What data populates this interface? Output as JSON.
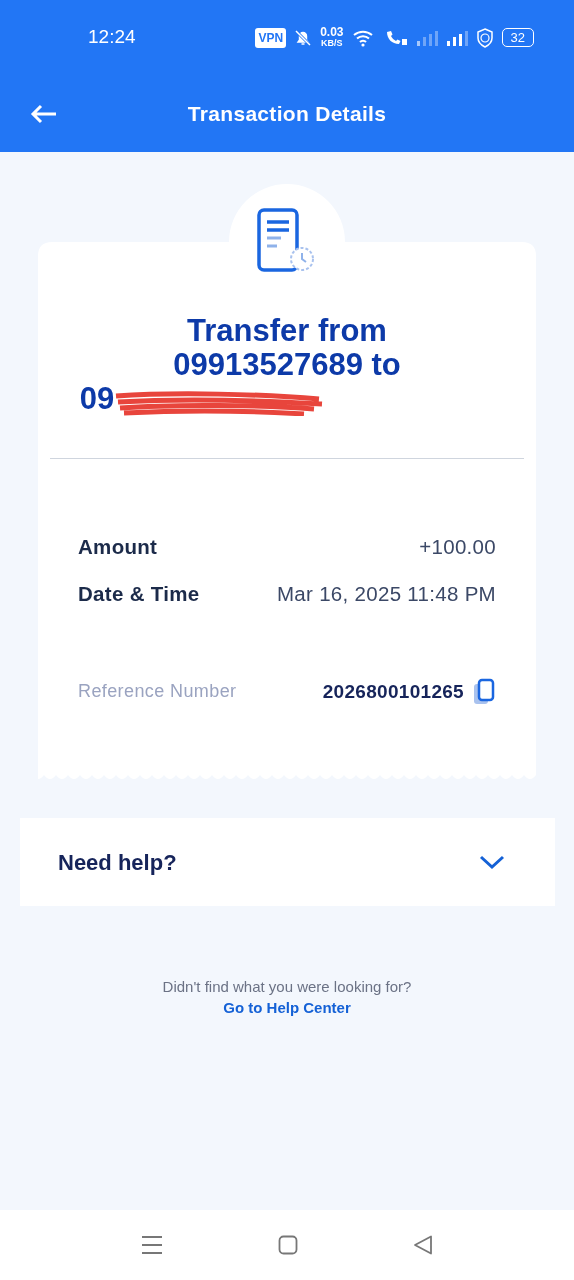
{
  "status_bar": {
    "time": "12:24",
    "vpn": "VPN",
    "speed": "0.03",
    "speed_unit": "KB/S",
    "battery": "32"
  },
  "header": {
    "title": "Transaction Details"
  },
  "receipt": {
    "title_lines": [
      "Transfer from",
      "09913527689 to",
      "09"
    ],
    "redacted": true,
    "rows": [
      {
        "label": "Amount",
        "value": "+100.00"
      },
      {
        "label": "Date & Time",
        "value": "Mar 16, 2025 11:48 PM"
      }
    ],
    "reference": {
      "label": "Reference Number",
      "value": "2026800101265"
    }
  },
  "help": {
    "label": "Need help?",
    "expanded": false
  },
  "footer": {
    "text": "Didn't find what you were looking for?",
    "link": "Go to Help Center"
  }
}
